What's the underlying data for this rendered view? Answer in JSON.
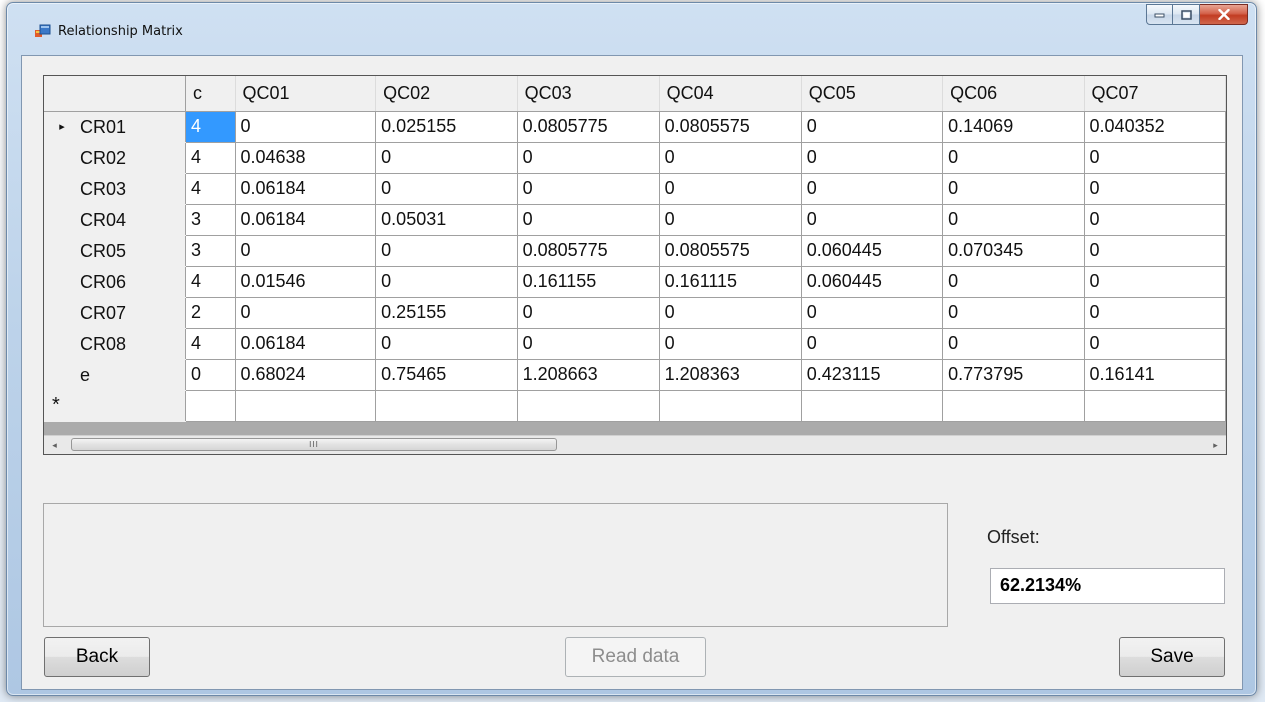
{
  "window": {
    "title": "Relationship Matrix"
  },
  "grid": {
    "columns": [
      "c",
      "QC01",
      "QC02",
      "QC03",
      "QC04",
      "QC05",
      "QC06",
      "QC07"
    ],
    "current_row_marker": "▸",
    "new_row_marker": "*",
    "selected_cell": {
      "row": "CR01",
      "column": "c"
    },
    "rows": [
      {
        "label": "CR01",
        "cells": [
          "4",
          "0",
          "0.025155",
          "0.0805775",
          "0.0805575",
          "0",
          "0.14069",
          "0.040352"
        ]
      },
      {
        "label": "CR02",
        "cells": [
          "4",
          "0.04638",
          "0",
          "0",
          "0",
          "0",
          "0",
          "0"
        ]
      },
      {
        "label": "CR03",
        "cells": [
          "4",
          "0.06184",
          "0",
          "0",
          "0",
          "0",
          "0",
          "0"
        ]
      },
      {
        "label": "CR04",
        "cells": [
          "3",
          "0.06184",
          "0.05031",
          "0",
          "0",
          "0",
          "0",
          "0"
        ]
      },
      {
        "label": "CR05",
        "cells": [
          "3",
          "0",
          "0",
          "0.0805775",
          "0.0805575",
          "0.060445",
          "0.070345",
          "0"
        ]
      },
      {
        "label": "CR06",
        "cells": [
          "4",
          "0.01546",
          "0",
          "0.161155",
          "0.161115",
          "0.060445",
          "0",
          "0"
        ]
      },
      {
        "label": "CR07",
        "cells": [
          "2",
          "0",
          "0.25155",
          "0",
          "0",
          "0",
          "0",
          "0"
        ]
      },
      {
        "label": "CR08",
        "cells": [
          "4",
          "0.06184",
          "0",
          "0",
          "0",
          "0",
          "0",
          "0"
        ]
      },
      {
        "label": "e",
        "cells": [
          "0",
          "0.68024",
          "0.75465",
          "1.208663",
          "1.208363",
          "0.423115",
          "0.773795",
          "0.16141"
        ]
      }
    ],
    "scrollbar": {
      "left_arrow": "◂",
      "right_arrow": "▸",
      "thumb_grip": "III"
    }
  },
  "offset": {
    "label": "Offset:",
    "value": "62.2134%"
  },
  "buttons": {
    "back": "Back",
    "read_data": "Read data",
    "save": "Save"
  }
}
